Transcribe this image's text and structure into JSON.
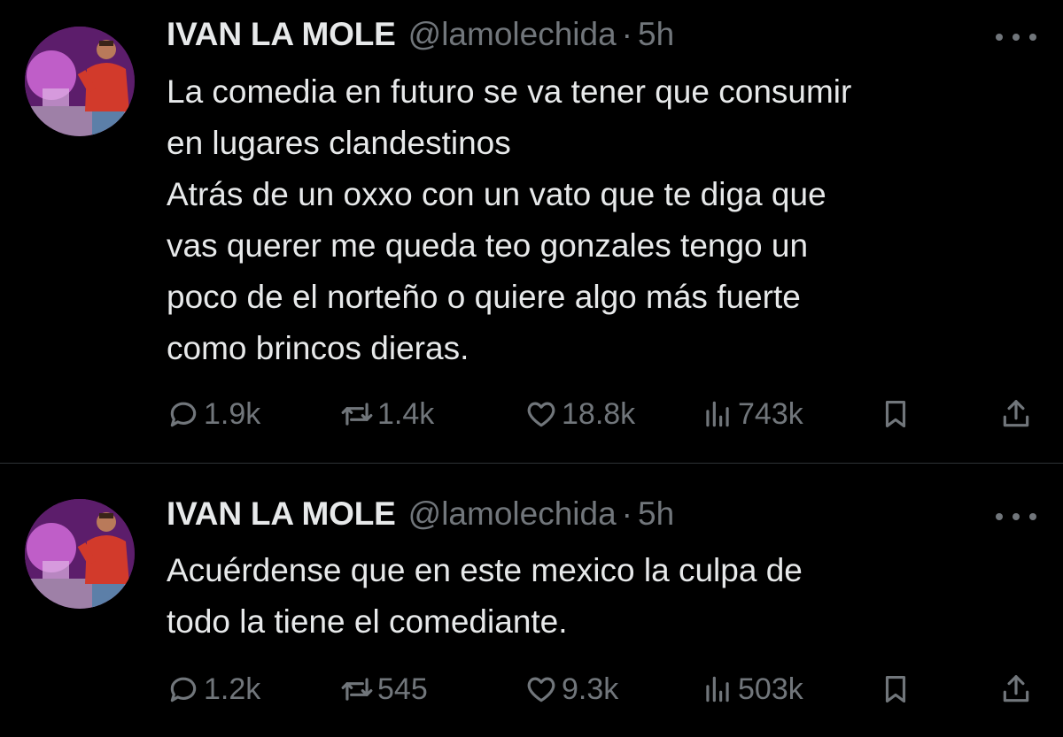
{
  "colors": {
    "background": "#000000",
    "primary_text": "#e7e9ea",
    "secondary_text": "#71767b",
    "divider": "#2f3336"
  },
  "tweets": [
    {
      "author_name": "IVAN LA MOLE",
      "handle": "@lamolechida",
      "separator": "·",
      "time": "5h",
      "text": "La comedia en futuro se va tener que consumir\nen lugares clandestinos\nAtrás de un oxxo con un vato que te diga que\nvas querer me queda teo gonzales tengo un\npoco de el norteño o quiere algo más fuerte\ncomo brincos dieras.",
      "replies": "1.9k",
      "retweets": "1.4k",
      "likes": "18.8k",
      "views": "743k"
    },
    {
      "author_name": "IVAN LA MOLE",
      "handle": "@lamolechida",
      "separator": "·",
      "time": "5h",
      "text": "Acuérdense que en este mexico la culpa de\ntodo  la tiene el comediante.",
      "replies": "1.2k",
      "retweets": "545",
      "likes": "9.3k",
      "views": "503k"
    }
  ],
  "icons": {
    "reply": "reply-icon",
    "retweet": "retweet-icon",
    "like": "heart-icon",
    "views": "views-icon",
    "bookmark": "bookmark-icon",
    "share": "share-icon",
    "more": "more-icon"
  }
}
